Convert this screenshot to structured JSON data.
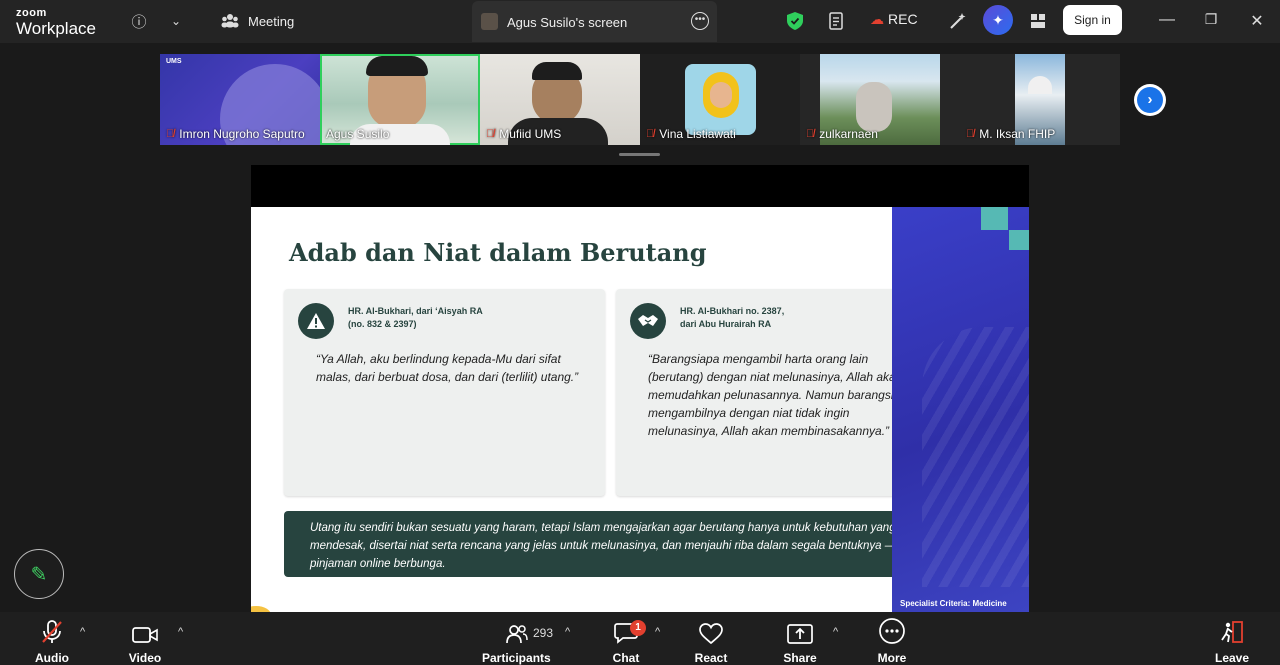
{
  "topbar": {
    "logo_top": "zoom",
    "logo_bottom": "Workplace",
    "meeting_label": "Meeting",
    "screen_tab_label": "Agus Susilo's screen",
    "rec_label": "REC",
    "signin_label": "Sign in"
  },
  "participants": [
    {
      "name": "Imron Nugroho Saputro"
    },
    {
      "name": "Agus Susilo"
    },
    {
      "name": "Mufiid UMS"
    },
    {
      "name": "Vina Listiawati"
    },
    {
      "name": "zulkarnaen"
    },
    {
      "name": "M. Iksan FHIP"
    }
  ],
  "slide": {
    "title": "Adab dan Niat dalam Berutang",
    "card1": {
      "ref": "HR. Al-Bukhari, dari ‘Aisyah RA\n(no. 832 & 2397)",
      "quote": "“Ya Allah, aku berlindung kepada-Mu dari sifat malas, dari berbuat dosa, dan dari (terlilit) utang.”"
    },
    "card2": {
      "ref": "HR. Al-Bukhari no. 2387,\ndari Abu Hurairah RA",
      "quote": "“Barangsiapa mengambil harta orang lain (berutang) dengan niat melunasinya, Allah akan memudahkan pelunasannya. Namun barangsiapa mengambilnya dengan niat tidak ingin melunasinya, Allah akan membinasakannya.”"
    },
    "note": "Utang itu sendiri bukan sesuatu yang haram, tetapi Islam mengajarkan agar berutang hanya untuk kebutuhan yang benar-benar mendesak, disertai niat serta rencana yang jelas untuk melunasinya, dan menjauhi riba dalam segala bentuknya — termasuk pinjaman online berbunga.",
    "footer": "Specialist Criteria: Medicine"
  },
  "toolbar": {
    "audio": "Audio",
    "video": "Video",
    "participants": "Participants",
    "participants_count": "293",
    "chat": "Chat",
    "chat_badge": "1",
    "react": "React",
    "share": "Share",
    "more": "More",
    "leave": "Leave"
  },
  "colors": {
    "slide_green": "#27443f",
    "active_border": "#2fcf5c",
    "mic_off": "#e2402f",
    "accent_blue": "#1a73e8"
  }
}
